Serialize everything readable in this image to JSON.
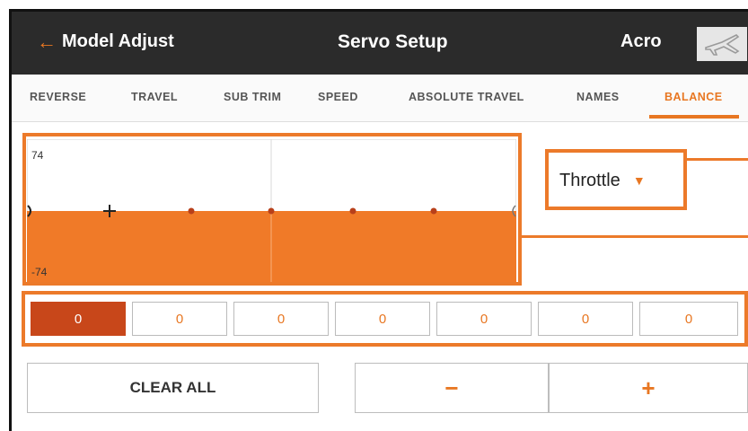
{
  "header": {
    "back_label": "Model Adjust",
    "title": "Servo Setup",
    "model_name": "Acro",
    "model_icon": "airplane-icon"
  },
  "tabs": [
    {
      "label": "REVERSE",
      "active": false
    },
    {
      "label": "TRAVEL",
      "active": false
    },
    {
      "label": "SUB TRIM",
      "active": false
    },
    {
      "label": "SPEED",
      "active": false
    },
    {
      "label": "ABSOLUTE TRAVEL",
      "active": false
    },
    {
      "label": "NAMES",
      "active": false
    },
    {
      "label": "BALANCE",
      "active": true
    }
  ],
  "curve": {
    "max_label": "74",
    "min_label": "-74",
    "selected_point": 1
  },
  "channel_select": {
    "value": "Throttle"
  },
  "balance_values": [
    "0",
    "0",
    "0",
    "0",
    "0",
    "0",
    "0"
  ],
  "selected_index": 0,
  "buttons": {
    "clear_all": "CLEAR ALL",
    "minus": "−",
    "plus": "+"
  },
  "colors": {
    "accent": "#e87722",
    "fill": "#f07a28",
    "header_bg": "#2b2b2b",
    "selected_cell": "#c8471a"
  }
}
